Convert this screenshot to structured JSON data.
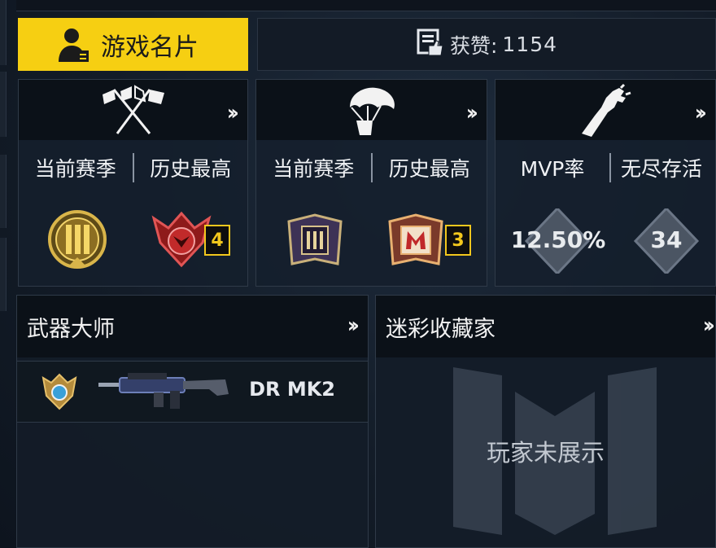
{
  "header": {
    "tab_label": "游戏名片",
    "likes_label": "获赞:",
    "likes_value": "1154"
  },
  "cards": [
    {
      "name": "multiplayer",
      "labels": [
        "当前赛季",
        "历史最高"
      ],
      "current_rank": "III",
      "best_level": "4"
    },
    {
      "name": "battle-royale",
      "labels": [
        "当前赛季",
        "历史最高"
      ],
      "current_rank": "III",
      "best_level": "3"
    },
    {
      "name": "zombies",
      "labels": [
        "MVP率",
        "无尽存活"
      ],
      "mvp_rate": "12.50%",
      "endless_survival": "34"
    }
  ],
  "weapon_master": {
    "title": "武器大师",
    "weapon_name": "DR MK2"
  },
  "camo_collector": {
    "title": "迷彩收藏家",
    "placeholder": "玩家未展示"
  },
  "colors": {
    "accent": "#f6cf12",
    "level_border": "#f2c71d"
  }
}
